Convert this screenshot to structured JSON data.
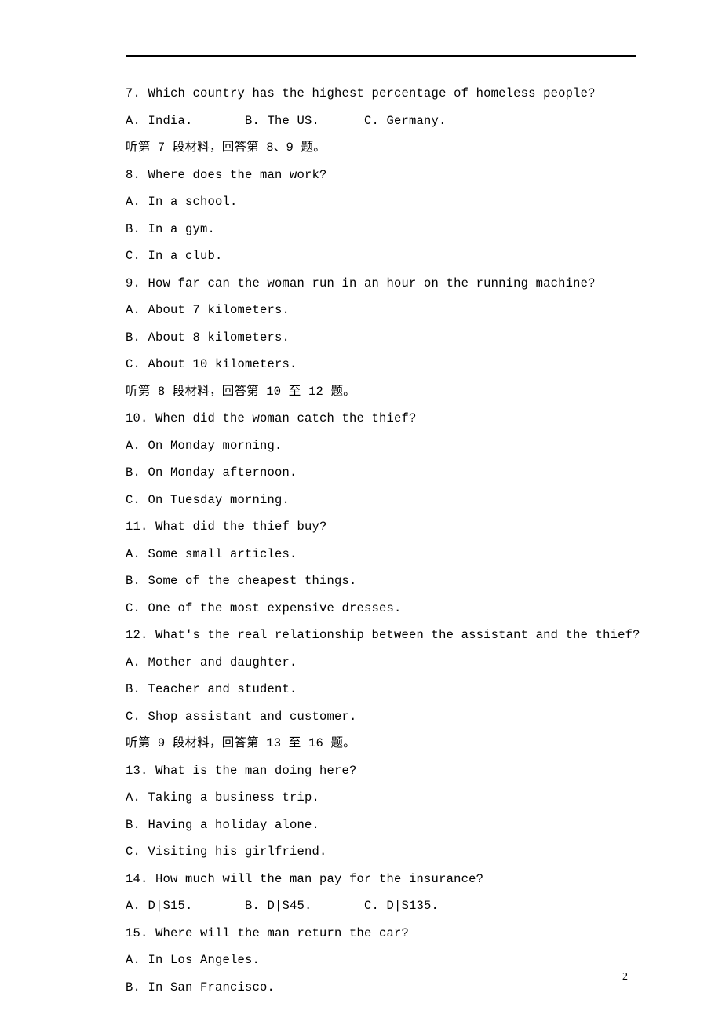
{
  "lines": [
    "7. Which country has the highest percentage of homeless people?",
    "A. India.       B. The US.      C. Germany.",
    "听第 7 段材料，回答第 8、9 题。",
    "8. Where does the man work?",
    "A. In a school.",
    "B. In a gym.",
    "C. In a club.",
    "9. How far can the woman run in an hour on the running machine?",
    "A. About 7 kilometers.",
    "B. About 8 kilometers.",
    "C. About 10 kilometers.",
    "听第 8 段材料，回答第 10 至 12 题。",
    "10. When did the woman catch the thief?",
    "A. On Monday morning.",
    "B. On Monday afternoon.",
    "C. On Tuesday morning.",
    "11. What did the thief buy?",
    "A. Some small articles.",
    "B. Some of the cheapest things.",
    "C. One of the most expensive dresses.",
    "12. What's the real relationship between the assistant and the thief?",
    "A. Mother and daughter.",
    "B. Teacher and student.",
    "C. Shop assistant and customer.",
    "听第 9 段材料，回答第 13 至 16 题。",
    "13. What is the man doing here?",
    "A. Taking a business trip.",
    "B. Having a holiday alone.",
    "C. Visiting his girlfriend.",
    "14. How much will the man pay for the insurance?",
    "A. D|S15.       B. D|S45.       C. D|S135.",
    "15. Where will the man return the car?",
    "A. In Los Angeles.",
    "B. In San Francisco."
  ],
  "page_number": "2"
}
